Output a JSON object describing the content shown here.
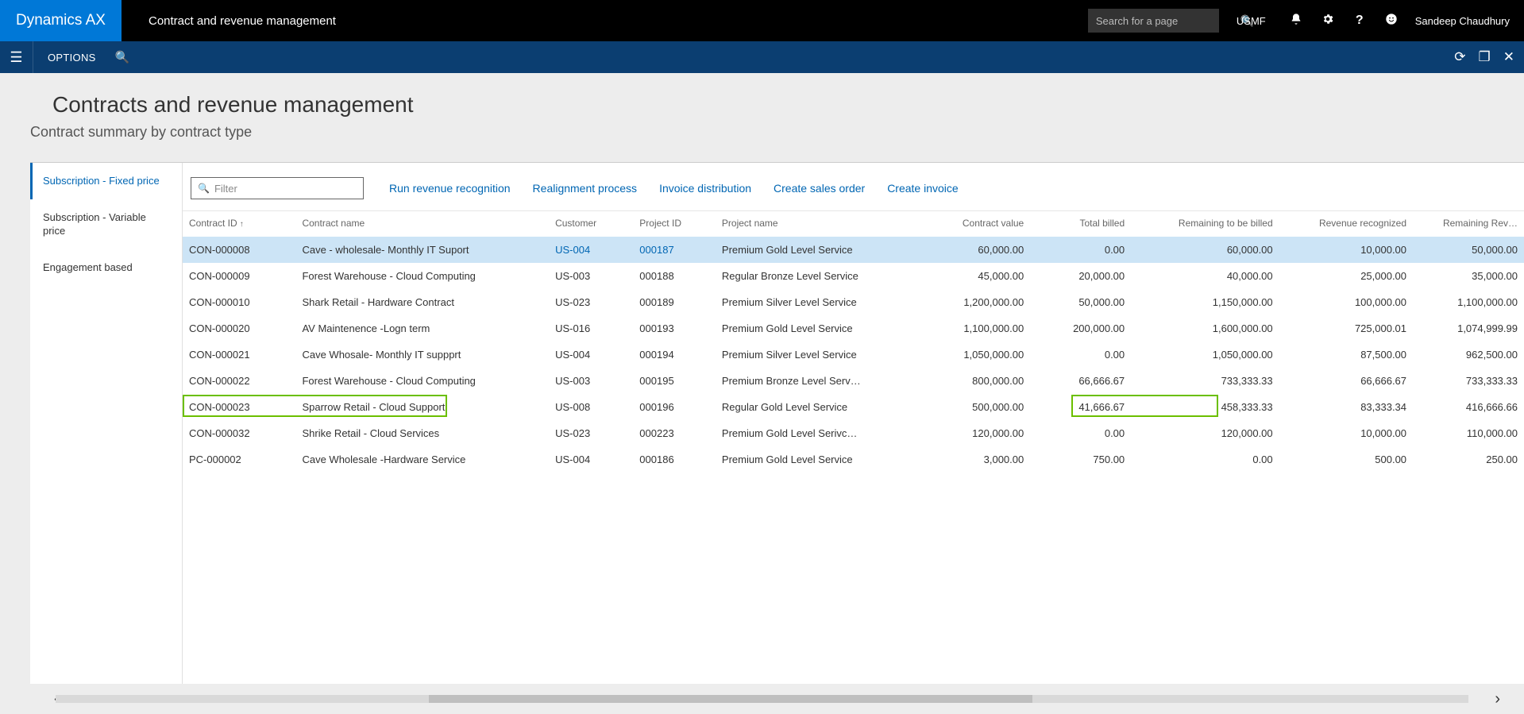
{
  "header": {
    "brand": "Dynamics AX",
    "module": "Contract and revenue management",
    "search_placeholder": "Search for a page",
    "company": "USMF",
    "user": "Sandeep Chaudhury"
  },
  "bluebar": {
    "options": "OPTIONS"
  },
  "page": {
    "title": "Contracts and revenue management",
    "subtitle": "Contract summary by contract type"
  },
  "sidebar": {
    "items": [
      {
        "label": "Subscription - Fixed price",
        "selected": true
      },
      {
        "label": "Subscription - Variable price",
        "selected": false
      },
      {
        "label": "Engagement based",
        "selected": false
      }
    ]
  },
  "toolbar": {
    "filter_placeholder": "Filter",
    "actions": [
      "Run revenue recognition",
      "Realignment process",
      "Invoice distribution",
      "Create sales order",
      "Create invoice"
    ]
  },
  "columns": [
    "Contract ID",
    "Contract name",
    "Customer",
    "Project ID",
    "Project name",
    "Contract value",
    "Total billed",
    "Remaining to be billed",
    "Revenue recognized",
    "Remaining Rev…"
  ],
  "sort": {
    "col": 0,
    "dir": "asc"
  },
  "rows": [
    {
      "selected": true,
      "id": "CON-000008",
      "name": "Cave - wholesale- Monthly IT Suport",
      "cust": "US-004",
      "cust_link": true,
      "proj": "000187",
      "proj_link": true,
      "pname": "Premium Gold Level Service",
      "val": "60,000.00",
      "billed": "0.00",
      "rem": "60,000.00",
      "rev": "10,000.00",
      "remrev": "50,000.00"
    },
    {
      "id": "CON-000009",
      "name": "Forest Warehouse - Cloud Computing",
      "cust": "US-003",
      "proj": "000188",
      "pname": "Regular Bronze Level Service",
      "val": "45,000.00",
      "billed": "20,000.00",
      "rem": "40,000.00",
      "rev": "25,000.00",
      "remrev": "35,000.00"
    },
    {
      "id": "CON-000010",
      "name": "Shark Retail - Hardware Contract",
      "cust": "US-023",
      "proj": "000189",
      "pname": "Premium Silver Level Service",
      "val": "1,200,000.00",
      "billed": "50,000.00",
      "rem": "1,150,000.00",
      "rev": "100,000.00",
      "remrev": "1,100,000.00"
    },
    {
      "id": "CON-000020",
      "name": "AV Maintenence -Logn term",
      "cust": "US-016",
      "proj": "000193",
      "pname": "Premium Gold Level Service",
      "val": "1,100,000.00",
      "billed": "200,000.00",
      "rem": "1,600,000.00",
      "rev": "725,000.01",
      "remrev": "1,074,999.99"
    },
    {
      "id": "CON-000021",
      "name": "Cave Whosale- Monthly IT suppprt",
      "cust": "US-004",
      "proj": "000194",
      "pname": "Premium Silver Level Service",
      "val": "1,050,000.00",
      "billed": "0.00",
      "rem": "1,050,000.00",
      "rev": "87,500.00",
      "remrev": "962,500.00"
    },
    {
      "id": "CON-000022",
      "name": "Forest Warehouse - Cloud Computing",
      "cust": "US-003",
      "proj": "000195",
      "pname": "Premium Bronze Level Serv…",
      "val": "800,000.00",
      "billed": "66,666.67",
      "rem": "733,333.33",
      "rev": "66,666.67",
      "remrev": "733,333.33"
    },
    {
      "id": "CON-000023",
      "name": "Sparrow Retail - Cloud Support",
      "cust": "US-008",
      "proj": "000196",
      "pname": "Regular Gold Level Service",
      "val": "500,000.00",
      "billed": "41,666.67",
      "rem": "458,333.33",
      "rev": "83,333.34",
      "remrev": "416,666.66"
    },
    {
      "id": "CON-000032",
      "name": "Shrike Retail - Cloud Services",
      "cust": "US-023",
      "proj": "000223",
      "pname": "Premium Gold Level Serivc…",
      "val": "120,000.00",
      "billed": "0.00",
      "rem": "120,000.00",
      "rev": "10,000.00",
      "remrev": "110,000.00"
    },
    {
      "id": "PC-000002",
      "name": "Cave Wholesale -Hardware Service",
      "cust": "US-004",
      "proj": "000186",
      "pname": "Premium Gold Level Service",
      "val": "3,000.00",
      "billed": "750.00",
      "rem": "0.00",
      "rev": "500.00",
      "remrev": "250.00"
    }
  ]
}
